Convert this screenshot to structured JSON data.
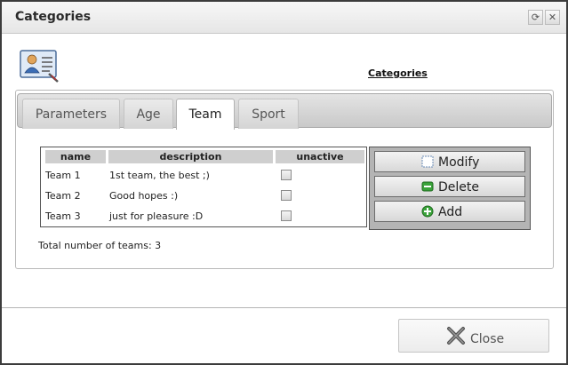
{
  "window": {
    "title": "Categories"
  },
  "header": {
    "label": "Categories"
  },
  "tabs": [
    {
      "label": "Parameters",
      "active": false
    },
    {
      "label": "Age",
      "active": false
    },
    {
      "label": "Team",
      "active": true
    },
    {
      "label": "Sport",
      "active": false
    }
  ],
  "table": {
    "columns": [
      "name",
      "description",
      "unactive"
    ],
    "rows": [
      {
        "name": "Team 1",
        "description": "1st team, the best ;)",
        "unactive": false
      },
      {
        "name": "Team 2",
        "description": "Good hopes :)",
        "unactive": false
      },
      {
        "name": "Team 3",
        "description": "just for pleasure :D",
        "unactive": false
      }
    ]
  },
  "actions": {
    "modify": "Modify",
    "delete": "Delete",
    "add": "Add"
  },
  "total_text": "Total number of teams: 3",
  "footer": {
    "close": "Close"
  },
  "icons": {
    "title_refresh": "refresh-icon",
    "title_close": "close-icon",
    "header": "categories-icon",
    "modify": "modify-icon",
    "delete": "delete-icon",
    "add": "add-icon",
    "close": "close-x-icon"
  },
  "colors": {
    "add_icon": "#2e9b2e",
    "delete_icon": "#2e8b2e"
  }
}
